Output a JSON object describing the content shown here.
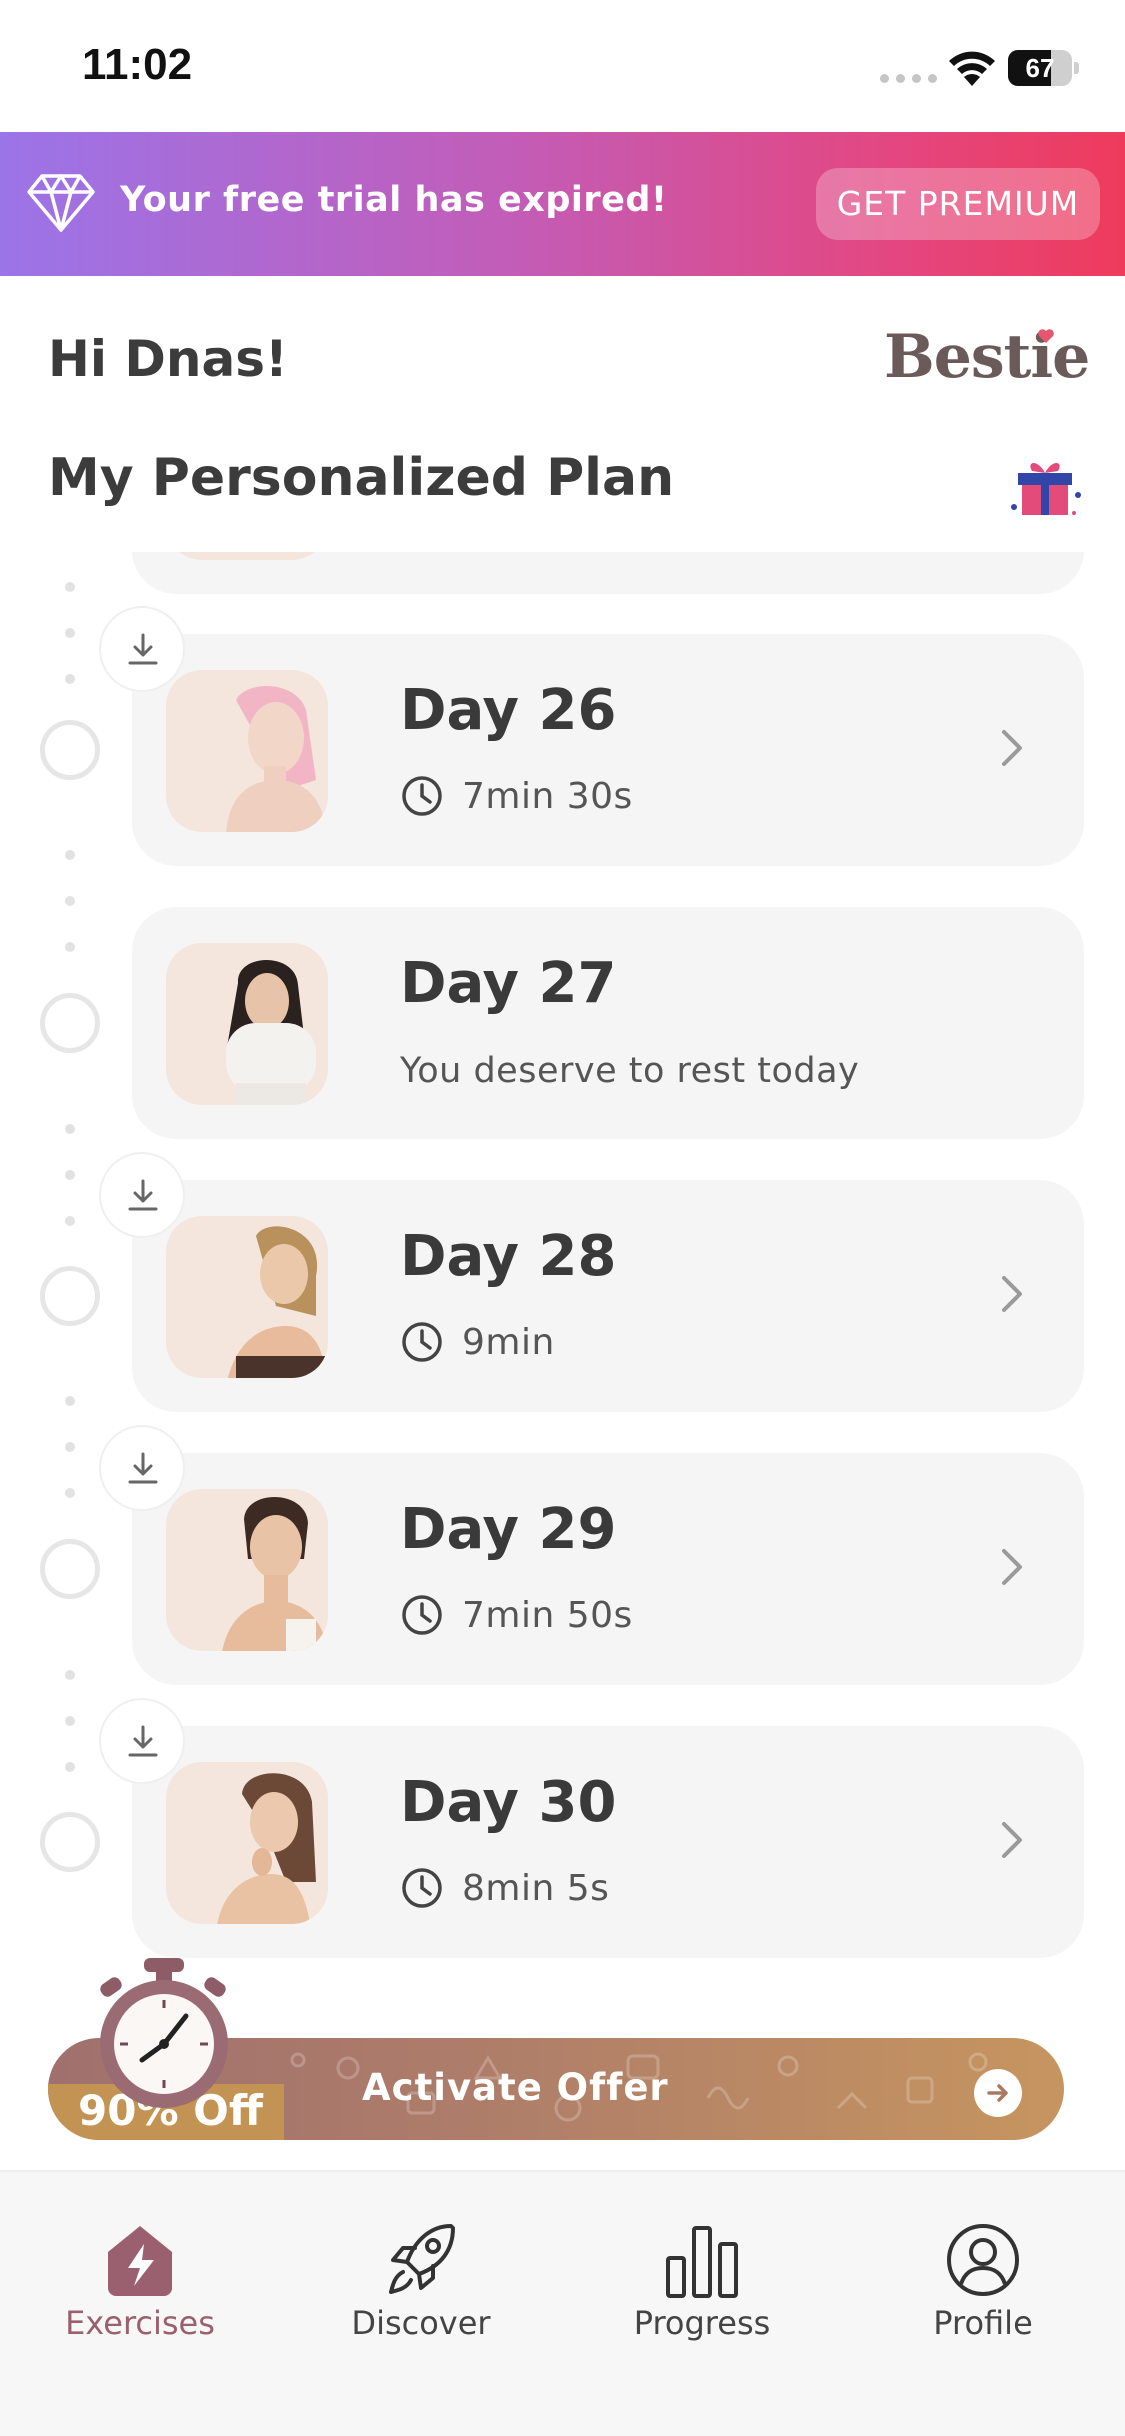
{
  "status_bar": {
    "time": "11:02",
    "battery": "67",
    "battery_fraction": 0.67
  },
  "banner": {
    "message": "Your free trial has expired!",
    "cta": "GET PREMIUM"
  },
  "header": {
    "greeting": "Hi Dnas!",
    "brand": "Bestie",
    "plan_title": "My Personalized Plan"
  },
  "plan": {
    "days": [
      {
        "title": "Day 26",
        "duration": "7min 30s",
        "rest": false,
        "downloadable": true
      },
      {
        "title": "Day 27",
        "note": "You deserve to rest today",
        "rest": true,
        "downloadable": false
      },
      {
        "title": "Day 28",
        "duration": "9min",
        "rest": false,
        "downloadable": true
      },
      {
        "title": "Day 29",
        "duration": "7min 50s",
        "rest": false,
        "downloadable": true
      },
      {
        "title": "Day 30",
        "duration": "8min 5s",
        "rest": false,
        "downloadable": true
      }
    ]
  },
  "offer": {
    "discount": "90% Off",
    "label": "Activate Offer"
  },
  "tabs": [
    {
      "label": "Exercises",
      "icon": "home-lightning-icon",
      "active": true
    },
    {
      "label": "Discover",
      "icon": "rocket-icon",
      "active": false
    },
    {
      "label": "Progress",
      "icon": "bar-chart-icon",
      "active": false
    },
    {
      "label": "Profile",
      "icon": "user-circle-icon",
      "active": false
    }
  ],
  "colors": {
    "accent": "#9b6070",
    "banner_start": "#9b74e8",
    "banner_end": "#ee3b5c",
    "offer": "#c29352"
  }
}
